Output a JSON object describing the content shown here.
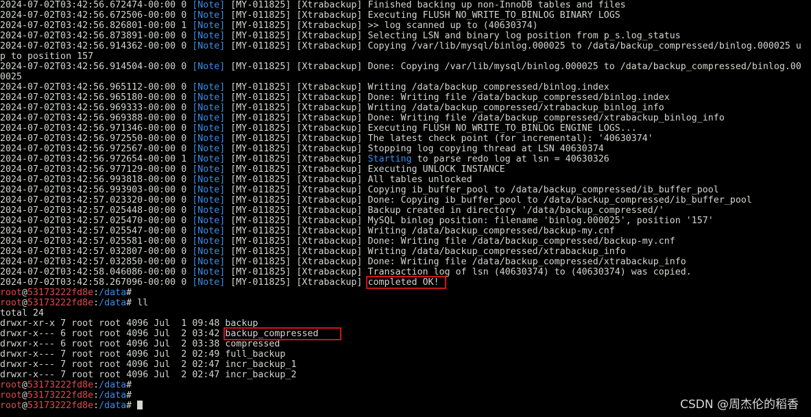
{
  "log": [
    {
      "ts": "2024-07-02T03:42:56.672474-00:00",
      "tid": "0",
      "level": "[Note]",
      "code": "[MY-011825]",
      "src": "[Xtrabackup]",
      "msg": "Finished backing up non-InnoDB tables and files"
    },
    {
      "ts": "2024-07-02T03:42:56.672506-00:00",
      "tid": "0",
      "level": "[Note]",
      "code": "[MY-011825]",
      "src": "[Xtrabackup]",
      "msg": "Executing FLUSH NO_WRITE_TO_BINLOG BINARY LOGS"
    },
    {
      "ts": "2024-07-02T03:42:56.826801-00:00",
      "tid": "1",
      "level": "[Note]",
      "code": "[MY-011825]",
      "src": "[Xtrabackup]",
      "msg": ">> log scanned up to (40630374)"
    },
    {
      "ts": "2024-07-02T03:42:56.873891-00:00",
      "tid": "0",
      "level": "[Note]",
      "code": "[MY-011825]",
      "src": "[Xtrabackup]",
      "msg": "Selecting LSN and binary log position from p_s.log_status"
    },
    {
      "ts": "2024-07-02T03:42:56.914362-00:00",
      "tid": "0",
      "level": "[Note]",
      "code": "[MY-011825]",
      "src": "[Xtrabackup]",
      "msg": "Copying /var/lib/mysql/binlog.000025 to /data/backup_compressed/binlog.000025 u"
    },
    {
      "cont": "p to position 157"
    },
    {
      "ts": "2024-07-02T03:42:56.914504-00:00",
      "tid": "0",
      "level": "[Note]",
      "code": "[MY-011825]",
      "src": "[Xtrabackup]",
      "msg": "Done: Copying /var/lib/mysql/binlog.000025 to /data/backup_compressed/binlog.00"
    },
    {
      "cont": "0025"
    },
    {
      "ts": "2024-07-02T03:42:56.965112-00:00",
      "tid": "0",
      "level": "[Note]",
      "code": "[MY-011825]",
      "src": "[Xtrabackup]",
      "msg": "Writing /data/backup_compressed/binlog.index"
    },
    {
      "ts": "2024-07-02T03:42:56.965180-00:00",
      "tid": "0",
      "level": "[Note]",
      "code": "[MY-011825]",
      "src": "[Xtrabackup]",
      "msg": "Done: Writing file /data/backup_compressed/binlog.index"
    },
    {
      "ts": "2024-07-02T03:42:56.969333-00:00",
      "tid": "0",
      "level": "[Note]",
      "code": "[MY-011825]",
      "src": "[Xtrabackup]",
      "msg": "Writing /data/backup_compressed/xtrabackup_binlog_info"
    },
    {
      "ts": "2024-07-02T03:42:56.969388-00:00",
      "tid": "0",
      "level": "[Note]",
      "code": "[MY-011825]",
      "src": "[Xtrabackup]",
      "msg": "Done: Writing file /data/backup_compressed/xtrabackup_binlog_info"
    },
    {
      "ts": "2024-07-02T03:42:56.971346-00:00",
      "tid": "0",
      "level": "[Note]",
      "code": "[MY-011825]",
      "src": "[Xtrabackup]",
      "msg": "Executing FLUSH NO_WRITE_TO_BINLOG ENGINE LOGS..."
    },
    {
      "ts": "2024-07-02T03:42:56.972550-00:00",
      "tid": "0",
      "level": "[Note]",
      "code": "[MY-011825]",
      "src": "[Xtrabackup]",
      "msg": "The latest check point (for incremental): '40630374'"
    },
    {
      "ts": "2024-07-02T03:42:56.972567-00:00",
      "tid": "0",
      "level": "[Note]",
      "code": "[MY-011825]",
      "src": "[Xtrabackup]",
      "msg": "Stopping log copying thread at LSN 40630374"
    },
    {
      "ts": "2024-07-02T03:42:56.972654-00:00",
      "tid": "1",
      "level": "[Note]",
      "code": "[MY-011825]",
      "src": "[Xtrabackup]",
      "msg_hl": "Starting",
      "msg": " to parse redo log at lsn = 40630326"
    },
    {
      "ts": "2024-07-02T03:42:56.977129-00:00",
      "tid": "0",
      "level": "[Note]",
      "code": "[MY-011825]",
      "src": "[Xtrabackup]",
      "msg": "Executing UNLOCK INSTANCE"
    },
    {
      "ts": "2024-07-02T03:42:56.993818-00:00",
      "tid": "0",
      "level": "[Note]",
      "code": "[MY-011825]",
      "src": "[Xtrabackup]",
      "msg": "All tables unlocked"
    },
    {
      "ts": "2024-07-02T03:42:56.993903-00:00",
      "tid": "0",
      "level": "[Note]",
      "code": "[MY-011825]",
      "src": "[Xtrabackup]",
      "msg": "Copying ib_buffer_pool to /data/backup_compressed/ib_buffer_pool"
    },
    {
      "ts": "2024-07-02T03:42:57.023320-00:00",
      "tid": "0",
      "level": "[Note]",
      "code": "[MY-011825]",
      "src": "[Xtrabackup]",
      "msg": "Done: Copying ib_buffer_pool to /data/backup_compressed/ib_buffer_pool"
    },
    {
      "ts": "2024-07-02T03:42:57.025448-00:00",
      "tid": "0",
      "level": "[Note]",
      "code": "[MY-011825]",
      "src": "[Xtrabackup]",
      "msg": "Backup created in directory '/data/backup_compressed/'"
    },
    {
      "ts": "2024-07-02T03:42:57.025470-00:00",
      "tid": "0",
      "level": "[Note]",
      "code": "[MY-011825]",
      "src": "[Xtrabackup]",
      "msg": "MySQL binlog position: filename 'binlog.000025', position '157'"
    },
    {
      "ts": "2024-07-02T03:42:57.025547-00:00",
      "tid": "0",
      "level": "[Note]",
      "code": "[MY-011825]",
      "src": "[Xtrabackup]",
      "msg": "Writing /data/backup_compressed/backup-my.cnf"
    },
    {
      "ts": "2024-07-02T03:42:57.025581-00:00",
      "tid": "0",
      "level": "[Note]",
      "code": "[MY-011825]",
      "src": "[Xtrabackup]",
      "msg": "Done: Writing file /data/backup_compressed/backup-my.cnf"
    },
    {
      "ts": "2024-07-02T03:42:57.032807-00:00",
      "tid": "0",
      "level": "[Note]",
      "code": "[MY-011825]",
      "src": "[Xtrabackup]",
      "msg": "Writing /data/backup_compressed/xtrabackup_info"
    },
    {
      "ts": "2024-07-02T03:42:57.032850-00:00",
      "tid": "0",
      "level": "[Note]",
      "code": "[MY-011825]",
      "src": "[Xtrabackup]",
      "msg": "Done: Writing file /data/backup_compressed/xtrabackup_info"
    },
    {
      "ts": "2024-07-02T03:42:58.046086-00:00",
      "tid": "0",
      "level": "[Note]",
      "code": "[MY-011825]",
      "src": "[Xtrabackup]",
      "msg": "Transaction log of lsn (40630374) to (40630374) was copied."
    },
    {
      "ts": "2024-07-02T03:42:58.267096-00:00",
      "tid": "0",
      "level": "[Note]",
      "code": "[MY-011825]",
      "src": "[Xtrabackup]",
      "msg_box": "completed OK! "
    }
  ],
  "prompt": {
    "user": "root",
    "at": "@",
    "host": "53173222fd8e",
    "sep": ":",
    "path": "/data",
    "sym": "# "
  },
  "command_ll": "ll",
  "total_line": "total 24",
  "listing": [
    {
      "perm": "drwxr-xr-x",
      "links": "7",
      "owner": "root",
      "group": "root",
      "size": "4096",
      "month": "Jul",
      "day": " 1",
      "time": "09:48",
      "name": "backup",
      "boxed": false
    },
    {
      "perm": "drwxr-x---",
      "links": "6",
      "owner": "root",
      "group": "root",
      "size": "4096",
      "month": "Jul",
      "day": " 2",
      "time": "03:42",
      "name": "backup_compressed",
      "boxed": true
    },
    {
      "perm": "drwxr-x---",
      "links": "6",
      "owner": "root",
      "group": "root",
      "size": "4096",
      "month": "Jul",
      "day": " 2",
      "time": "03:38",
      "name": "compressed",
      "boxed": false
    },
    {
      "perm": "drwxr-x---",
      "links": "7",
      "owner": "root",
      "group": "root",
      "size": "4096",
      "month": "Jul",
      "day": " 2",
      "time": "02:49",
      "name": "full_backup",
      "boxed": false
    },
    {
      "perm": "drwxr-x---",
      "links": "7",
      "owner": "root",
      "group": "root",
      "size": "4096",
      "month": "Jul",
      "day": " 2",
      "time": "02:47",
      "name": "incr_backup_1",
      "boxed": false
    },
    {
      "perm": "drwxr-x---",
      "links": "7",
      "owner": "root",
      "group": "root",
      "size": "4096",
      "month": "Jul",
      "day": " 2",
      "time": "02:47",
      "name": "incr_backup_2",
      "boxed": false
    }
  ],
  "watermark": "CSDN @周杰伦的稻香",
  "colors": {
    "background": "#000000",
    "text": "#d3d7cf",
    "note": "#3b8eea",
    "prompt_user": "#e5484d",
    "highlight_box": "#d0141a"
  }
}
